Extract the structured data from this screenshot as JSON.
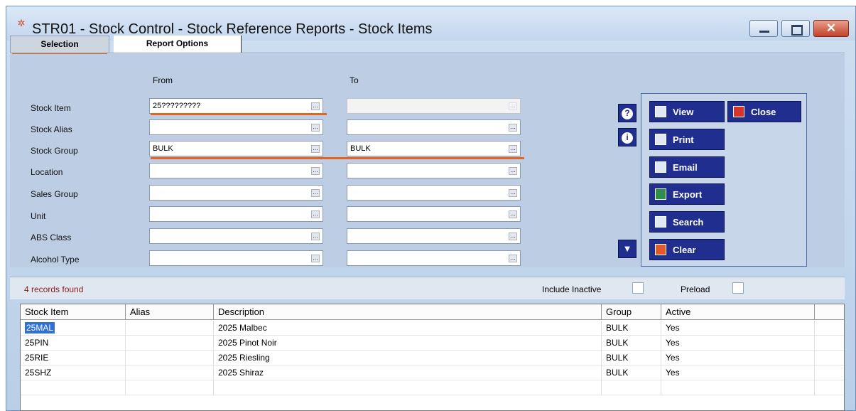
{
  "window": {
    "title": "STR01 - Stock Control - Stock Reference Reports - Stock Items",
    "close_glyph": "✕"
  },
  "tabs": [
    {
      "label": "Selection",
      "selected": true
    },
    {
      "label": "Report Options",
      "selected": false
    }
  ],
  "filters": {
    "from_header": "From",
    "to_header": "To",
    "rows": [
      {
        "label": "Stock Item",
        "from": "25?????????",
        "to": "",
        "to_disabled": true
      },
      {
        "label": "Stock Alias",
        "from": "",
        "to": ""
      },
      {
        "label": "Stock Group",
        "from": "BULK",
        "to": "BULK"
      },
      {
        "label": "Location",
        "from": "",
        "to": ""
      },
      {
        "label": "Sales Group",
        "from": "",
        "to": ""
      },
      {
        "label": "Unit",
        "from": "",
        "to": ""
      },
      {
        "label": "ABS Class",
        "from": "",
        "to": ""
      },
      {
        "label": "Alcohol Type",
        "from": "",
        "to": ""
      }
    ],
    "ellipsis": "..."
  },
  "actions": {
    "view": "View",
    "close": "Close",
    "print": "Print",
    "email": "Email",
    "export": "Export",
    "search": "Search",
    "clear": "Clear",
    "help_glyph": "?",
    "info_glyph": "i",
    "down_glyph": "▼"
  },
  "status": {
    "records_found": "4 records found",
    "include_inactive": "Include Inactive",
    "preload": "Preload"
  },
  "grid": {
    "columns": [
      "Stock Item",
      "Alias",
      "Description",
      "Group",
      "Active"
    ],
    "rows": [
      [
        "25MAL",
        "",
        "2025 Malbec",
        "BULK",
        "Yes"
      ],
      [
        "25PIN",
        "",
        "2025 Pinot Noir",
        "BULK",
        "Yes"
      ],
      [
        "25RIE",
        "",
        "2025 Riesling",
        "BULK",
        "Yes"
      ],
      [
        "25SHZ",
        "",
        "2025  Shiraz",
        "BULK",
        "Yes"
      ]
    ]
  },
  "colors": {
    "accent_underline": "#e8641e",
    "button_bg": "#1f2e8f",
    "records_text": "#8b1a1a",
    "selection": "#2f6fd6"
  }
}
